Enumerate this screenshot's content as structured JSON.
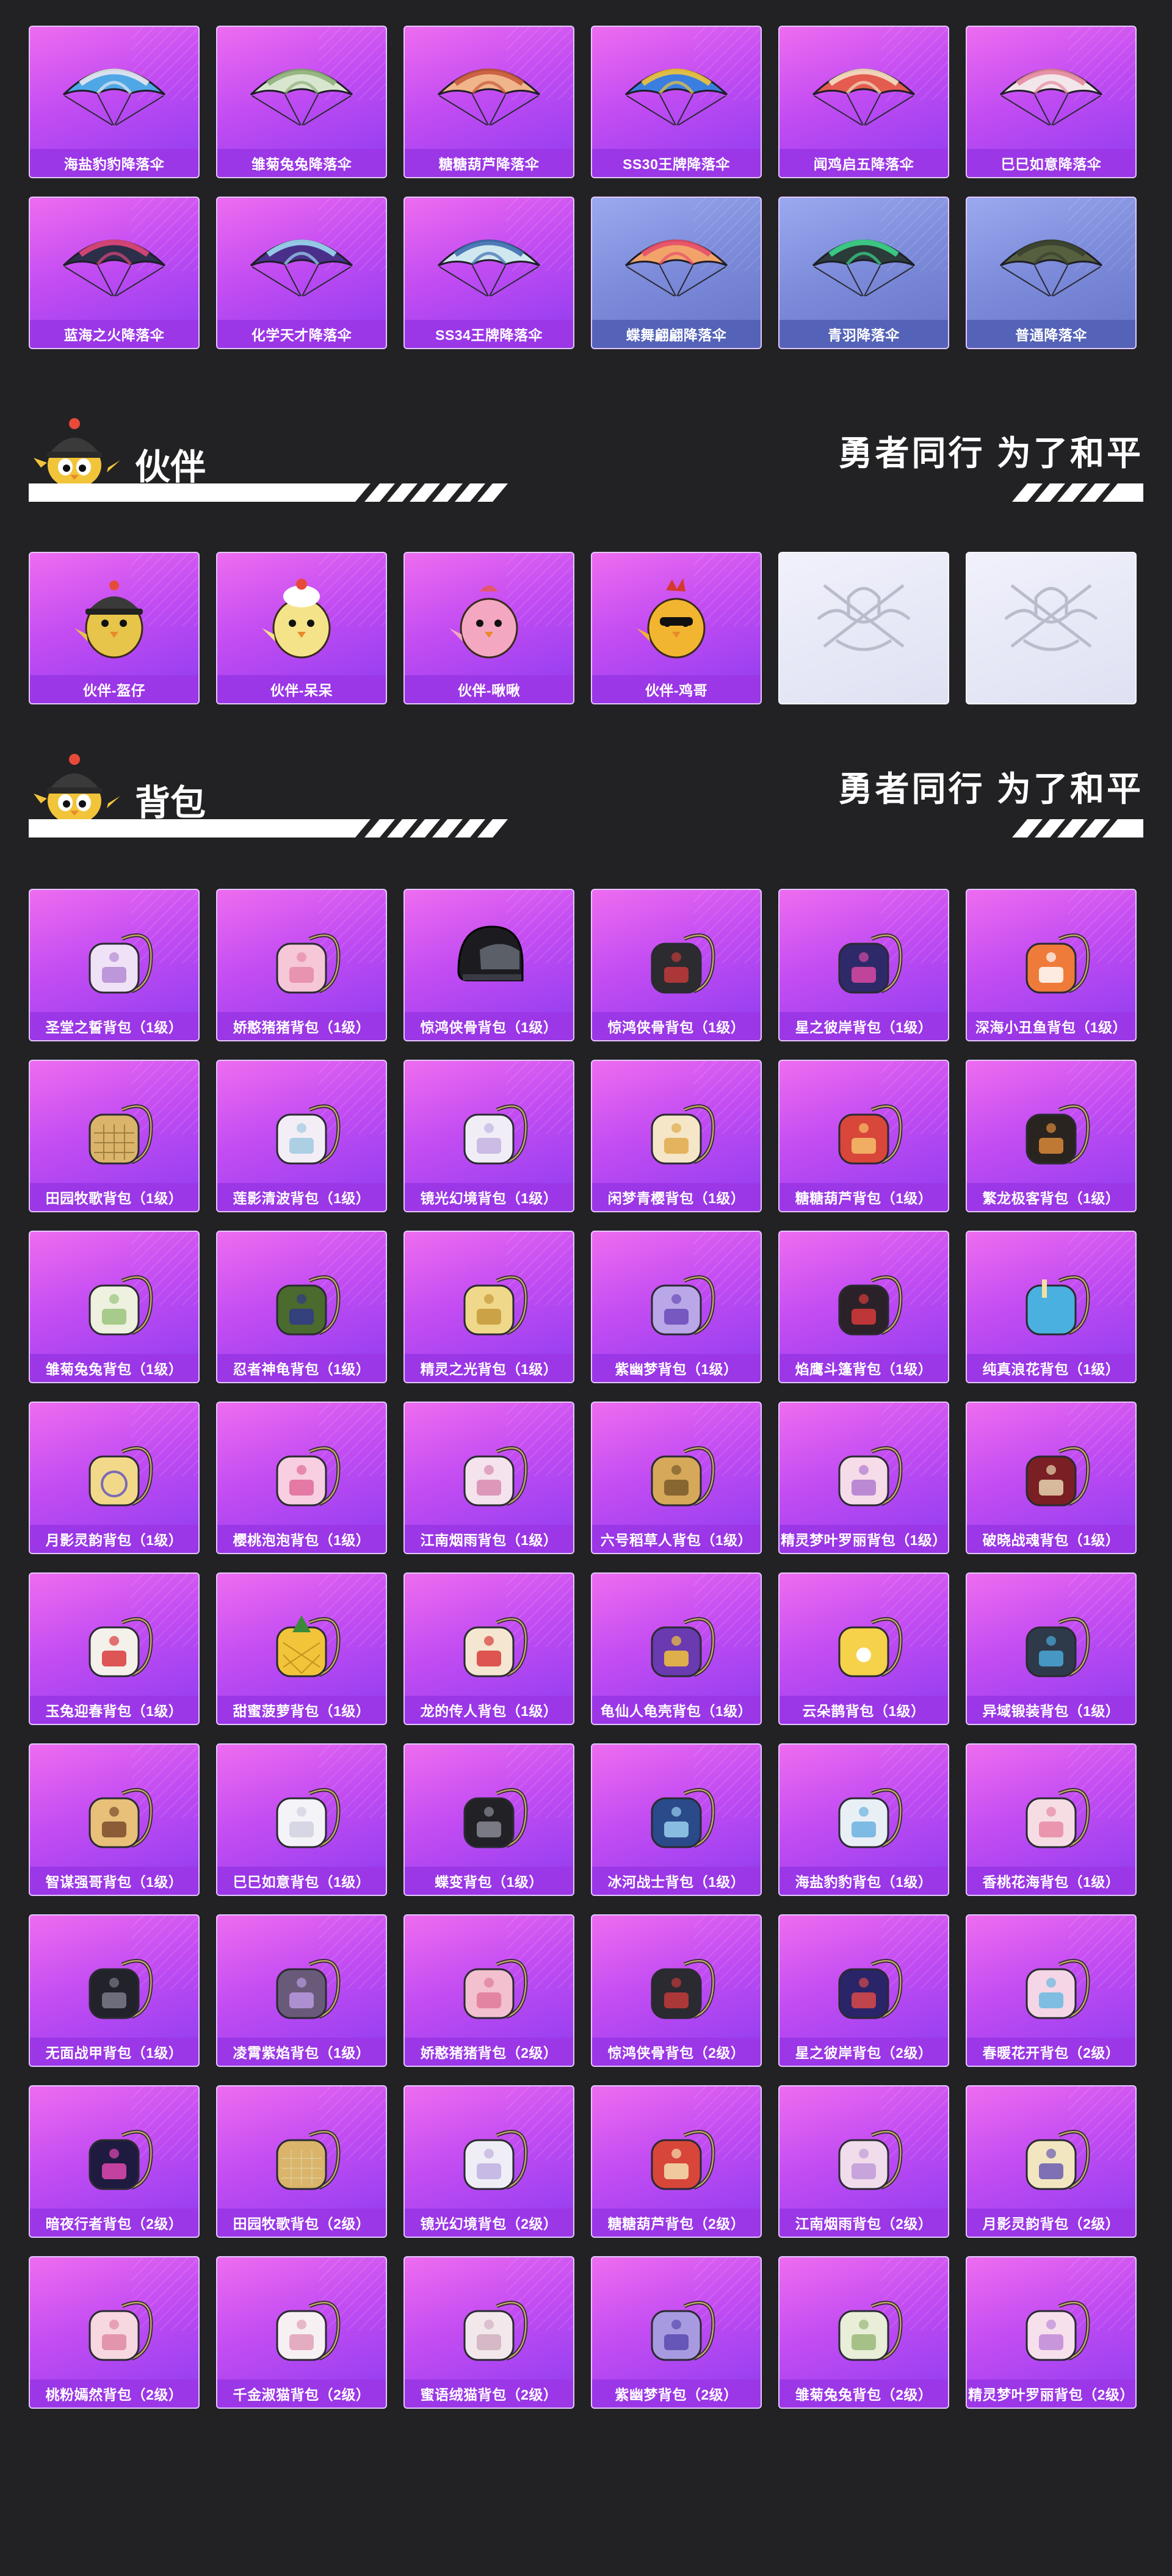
{
  "colors": {
    "background": "#222224",
    "card_purple": "#c24cf2",
    "card_label": "#9b37e6",
    "card_blue": "#7b8ad9",
    "card_silver": "#e5e7f6"
  },
  "parachutes": [
    {
      "label": "海盐豹豹降落伞",
      "icon": "parachute-icon",
      "tone": "purple",
      "canopy": "#4fa7e6",
      "accent": "#e8e8f0"
    },
    {
      "label": "雏菊兔兔降落伞",
      "icon": "parachute-icon",
      "tone": "purple",
      "canopy": "#d9e6cf",
      "accent": "#8fb07a"
    },
    {
      "label": "糖糖葫芦降落伞",
      "icon": "parachute-icon",
      "tone": "purple",
      "canopy": "#f0b58a",
      "accent": "#c85a3c"
    },
    {
      "label": "SS30王牌降落伞",
      "icon": "parachute-icon",
      "tone": "purple",
      "canopy": "#3a7ee0",
      "accent": "#f2c43a"
    },
    {
      "label": "闻鸡启五降落伞",
      "icon": "parachute-icon",
      "tone": "purple",
      "canopy": "#e35c4f",
      "accent": "#f4e0c2"
    },
    {
      "label": "巳巳如意降落伞",
      "icon": "parachute-icon",
      "tone": "purple",
      "canopy": "#f3e6ea",
      "accent": "#e58aa0"
    },
    {
      "label": "蓝海之火降落伞",
      "icon": "parachute-icon",
      "tone": "purple",
      "canopy": "#2b2f4a",
      "accent": "#e2477a"
    },
    {
      "label": "化学天才降落伞",
      "icon": "parachute-icon",
      "tone": "purple",
      "canopy": "#4a2f8a",
      "accent": "#9dd8f2"
    },
    {
      "label": "SS34王牌降落伞",
      "icon": "parachute-icon",
      "tone": "purple",
      "canopy": "#cfe7ee",
      "accent": "#3f6fb0"
    },
    {
      "label": "蝶舞翩翩降落伞",
      "icon": "parachute-icon",
      "tone": "blue",
      "canopy": "#f2a36a",
      "accent": "#e84f6c"
    },
    {
      "label": "青羽降落伞",
      "icon": "parachute-icon",
      "tone": "blue",
      "canopy": "#2a3b3a",
      "accent": "#3dd68c"
    },
    {
      "label": "普通降落伞",
      "icon": "parachute-icon",
      "tone": "blue",
      "canopy": "#56603e",
      "accent": "#3b4230"
    }
  ],
  "companion_section": {
    "title": "伙伴",
    "slogan": "勇者同行 为了和平"
  },
  "companions": [
    {
      "label": "伙伴-盔仔",
      "icon": "companion-helmet-chick-icon",
      "tone": "purple",
      "body": "#e7c44a",
      "hat": "#3a3a3a"
    },
    {
      "label": "伙伴-呆呆",
      "icon": "companion-chick-icon",
      "tone": "purple",
      "body": "#f5e38a",
      "hat": "#ffffff"
    },
    {
      "label": "伙伴-啾啾",
      "icon": "companion-pink-bird-icon",
      "tone": "purple",
      "body": "#f4a7c0",
      "hat": "#e4566f"
    },
    {
      "label": "伙伴-鸡哥",
      "icon": "companion-rooster-icon",
      "tone": "purple",
      "body": "#f1b530",
      "hat": "#d33a2c"
    },
    {
      "label": "",
      "icon": "pubg-emblem-icon",
      "tone": "silver"
    },
    {
      "label": "",
      "icon": "pubg-emblem-icon",
      "tone": "silver"
    }
  ],
  "backpack_section": {
    "title": "背包",
    "slogan": "勇者同行 为了和平"
  },
  "backpacks": [
    {
      "label": "圣堂之誓背包（1级）",
      "icon": "backpack-icon",
      "color": "#f0e2f6",
      "accent": "#b38ad4"
    },
    {
      "label": "娇憨猪猪背包（1级）",
      "icon": "backpack-icon",
      "color": "#f5c7d7",
      "accent": "#e58aa8"
    },
    {
      "label": "惊鸿侠骨背包（1级）",
      "icon": "helmet-backpack-icon",
      "color": "#1c1c20",
      "accent": "#9aa1ad"
    },
    {
      "label": "惊鸿侠骨背包（1级）",
      "icon": "backpack-icon",
      "color": "#2b2b30",
      "accent": "#c23a3a"
    },
    {
      "label": "星之彼岸背包（1级）",
      "icon": "backpack-icon",
      "color": "#2e2a6a",
      "accent": "#d94aa2"
    },
    {
      "label": "深海小丑鱼背包（1级）",
      "icon": "backpack-icon",
      "color": "#ef7b3a",
      "accent": "#ffffff"
    },
    {
      "label": "田园牧歌背包（1级）",
      "icon": "basket-backpack-icon",
      "color": "#d9b46a",
      "accent": "#8a6a2a"
    },
    {
      "label": "莲影清波背包（1级）",
      "icon": "backpack-icon",
      "color": "#f3eef5",
      "accent": "#9fc9e0"
    },
    {
      "label": "镜光幻境背包（1级）",
      "icon": "backpack-icon",
      "color": "#f1edf6",
      "accent": "#c3b3e2"
    },
    {
      "label": "闲梦青樱背包（1级）",
      "icon": "backpack-icon",
      "color": "#f6e6c8",
      "accent": "#e0a94a"
    },
    {
      "label": "糖糖葫芦背包（1级）",
      "icon": "backpack-icon",
      "color": "#d9463a",
      "accent": "#f4c06a"
    },
    {
      "label": "繁龙极客背包（1级）",
      "icon": "backpack-icon",
      "color": "#2a2420",
      "accent": "#d88a3a"
    },
    {
      "label": "雏菊兔兔背包（1级）",
      "icon": "backpack-icon",
      "color": "#eef0e0",
      "accent": "#9ac47a"
    },
    {
      "label": "忍者神龟背包（1级）",
      "icon": "backpack-icon",
      "color": "#4a6a2e",
      "accent": "#2f3a8a"
    },
    {
      "label": "精灵之光背包（1级）",
      "icon": "backpack-icon",
      "color": "#f0d88a",
      "accent": "#c49a3a"
    },
    {
      "label": "紫幽梦背包（1级）",
      "icon": "backpack-icon",
      "color": "#b9a7e8",
      "accent": "#6a4ab8"
    },
    {
      "label": "焰鹰斗篷背包（1级）",
      "icon": "backpack-icon",
      "color": "#2a2228",
      "accent": "#d83a3a"
    },
    {
      "label": "纯真浪花背包（1级）",
      "icon": "cup-backpack-icon",
      "color": "#4ab0e0",
      "accent": "#f2e0a0"
    },
    {
      "label": "月影灵韵背包（1级）",
      "icon": "coin-backpack-icon",
      "color": "#f2d98a",
      "accent": "#7a6ab8"
    },
    {
      "label": "樱桃泡泡背包（1级）",
      "icon": "backpack-icon",
      "color": "#f7cfe0",
      "accent": "#e06a9a"
    },
    {
      "label": "江南烟雨背包（1级）",
      "icon": "backpack-icon",
      "color": "#f4e2ec",
      "accent": "#d88ab0"
    },
    {
      "label": "六号稻草人背包（1级）",
      "icon": "backpack-icon",
      "color": "#d6a85a",
      "accent": "#7a5a2a"
    },
    {
      "label": "精灵梦叶罗丽背包（1级）",
      "icon": "backpack-icon",
      "color": "#f6dbe8",
      "accent": "#b07ad0"
    },
    {
      "label": "破晓战魂背包（1级）",
      "icon": "backpack-icon",
      "color": "#7a1f24",
      "accent": "#e8d6b0"
    },
    {
      "label": "玉兔迎春背包（1级）",
      "icon": "backpack-icon",
      "color": "#f4f0ea",
      "accent": "#d83a3a"
    },
    {
      "label": "甜蜜菠萝背包（1级）",
      "icon": "pineapple-backpack-icon",
      "color": "#f2c43a",
      "accent": "#3a8a3a"
    },
    {
      "label": "龙的传人背包（1级）",
      "icon": "backpack-icon",
      "color": "#f4e6d0",
      "accent": "#d83a3a"
    },
    {
      "label": "龟仙人龟壳背包（1级）",
      "icon": "backpack-icon",
      "color": "#6a3ab0",
      "accent": "#f2c43a"
    },
    {
      "label": "云朵鹊背包（1级）",
      "icon": "flower-backpack-icon",
      "color": "#f6d24a",
      "accent": "#ffffff"
    },
    {
      "label": "异域锻装背包（1级）",
      "icon": "backpack-icon",
      "color": "#2e3a4a",
      "accent": "#4aa8d8"
    },
    {
      "label": "智谋强哥背包（1级）",
      "icon": "backpack-icon",
      "color": "#e8c07a",
      "accent": "#7a4a2a"
    },
    {
      "label": "巳巳如意背包（1级）",
      "icon": "backpack-icon",
      "color": "#f4f4f8",
      "accent": "#d0d0e0"
    },
    {
      "label": "蝶变背包（1级）",
      "icon": "backpack-icon",
      "color": "#222226",
      "accent": "#8a8a96"
    },
    {
      "label": "冰河战士背包（1级）",
      "icon": "backpack-icon",
      "color": "#2a4a8a",
      "accent": "#9ad0f0"
    },
    {
      "label": "海盐豹豹背包（1级）",
      "icon": "backpack-icon",
      "color": "#e8f0f6",
      "accent": "#6ab0e0"
    },
    {
      "label": "香桃花海背包（1级）",
      "icon": "backpack-icon",
      "color": "#f6dde4",
      "accent": "#e88aa4"
    },
    {
      "label": "无面战甲背包（1级）",
      "icon": "backpack-icon",
      "color": "#22222a",
      "accent": "#7a7a8a"
    },
    {
      "label": "凌霄紫焰背包（1级）",
      "icon": "backpack-icon",
      "color": "#6a5a7a",
      "accent": "#b89ae0"
    },
    {
      "label": "娇憨猪猪背包（2级）",
      "icon": "backpack-icon",
      "color": "#f2c0cf",
      "accent": "#e07a9a"
    },
    {
      "label": "惊鸿侠骨背包（2级）",
      "icon": "backpack-icon",
      "color": "#2a2a30",
      "accent": "#c23a3a"
    },
    {
      "label": "星之彼岸背包（2级）",
      "icon": "backpack-icon",
      "color": "#2a2468",
      "accent": "#d94a4a"
    },
    {
      "label": "春暖花开背包（2级）",
      "icon": "backpack-icon",
      "color": "#f4d6e6",
      "accent": "#6ab8e0"
    },
    {
      "label": "暗夜行者背包（2级）",
      "icon": "backpack-icon",
      "color": "#1e1a40",
      "accent": "#e04ab0"
    },
    {
      "label": "田园牧歌背包（2级）",
      "icon": "basket-backpack-icon",
      "color": "#d9b46a",
      "accent": "#e0d0a0"
    },
    {
      "label": "镜光幻境背包（2级）",
      "icon": "backpack-icon",
      "color": "#efeef6",
      "accent": "#c0b0e0"
    },
    {
      "label": "糖糖葫芦背包（2级）",
      "icon": "backpack-icon",
      "color": "#d8463a",
      "accent": "#f4e0b0"
    },
    {
      "label": "江南烟雨背包（2级）",
      "icon": "backpack-icon",
      "color": "#f0dcea",
      "accent": "#c09ad8"
    },
    {
      "label": "月影灵韵背包（2级）",
      "icon": "backpack-icon",
      "color": "#f2e6c0",
      "accent": "#6a5ab0"
    },
    {
      "label": "桃粉嫣然背包（2级）",
      "icon": "backpack-icon",
      "color": "#f7d8e0",
      "accent": "#e08aa4"
    },
    {
      "label": "千金淑猫背包（2级）",
      "icon": "backpack-icon",
      "color": "#f6f0f2",
      "accent": "#e0a0b8"
    },
    {
      "label": "蜜语绒猫背包（2级）",
      "icon": "backpack-icon",
      "color": "#f2e8ec",
      "accent": "#d0b0c0"
    },
    {
      "label": "紫幽梦背包（2级）",
      "icon": "backpack-icon",
      "color": "#a89ae0",
      "accent": "#5a4ab0"
    },
    {
      "label": "雏菊兔兔背包（2级）",
      "icon": "backpack-icon",
      "color": "#e8eed8",
      "accent": "#9ab87a"
    },
    {
      "label": "精灵梦叶罗丽背包（2级）",
      "icon": "backpack-icon",
      "color": "#f6e0ec",
      "accent": "#c08ad8"
    }
  ]
}
